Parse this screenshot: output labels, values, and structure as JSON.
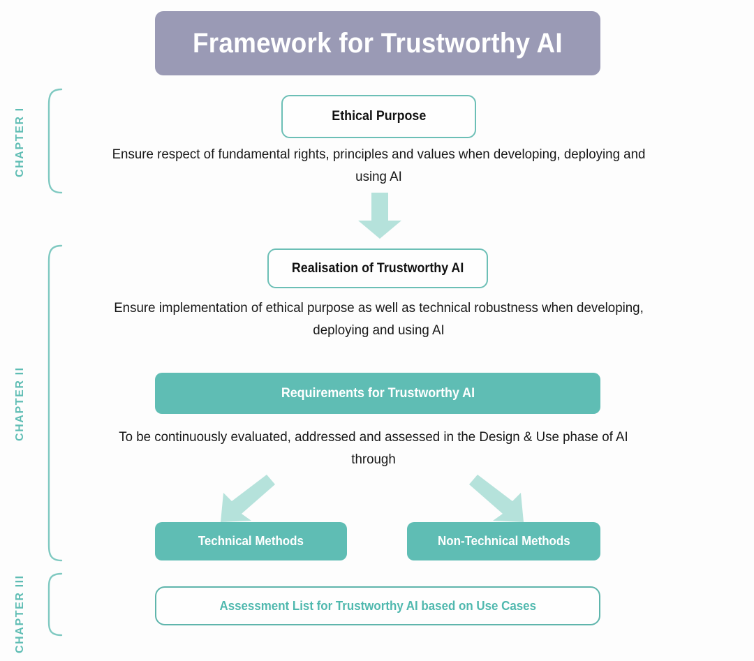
{
  "diagram": {
    "title": "Framework for Trustworthy AI",
    "colors": {
      "title_banner": "#9a9ab5",
      "teal_fill": "#5fbdb4",
      "teal_border": "#6cbfb6",
      "teal_text": "#4fb8ae",
      "arrow_light_teal": "#b5e2db",
      "body_text": "#171717",
      "background": "#ffffff"
    },
    "chapters": [
      {
        "label": "CHAPTER I"
      },
      {
        "label": "CHAPTER II"
      },
      {
        "label": "CHAPTER III"
      }
    ],
    "nodes": {
      "ethical_purpose": "Ethical Purpose",
      "realisation": "Realisation of Trustworthy AI",
      "requirements": "Requirements for Trustworthy AI",
      "technical_methods": "Technical Methods",
      "non_technical_methods": "Non-Technical Methods",
      "assessment_list": "Assessment List for Trustworthy AI based on Use Cases"
    },
    "captions": {
      "ethical_purpose": "Ensure respect of fundamental rights, principles and values when developing, deploying and using AI",
      "realisation": "Ensure implementation of ethical purpose as well as technical robustness when developing, deploying and using AI",
      "requirements": "To be continuously evaluated, addressed and assessed in the Design & Use phase of AI through"
    },
    "arrows": [
      {
        "name": "arrow-down",
        "direction": "down",
        "from": "ethical_purpose",
        "to": "realisation"
      },
      {
        "name": "arrow-down-left",
        "direction": "down-left",
        "from": "requirements",
        "to": "technical_methods"
      },
      {
        "name": "arrow-down-right",
        "direction": "down-right",
        "from": "requirements",
        "to": "non_technical_methods"
      }
    ]
  }
}
